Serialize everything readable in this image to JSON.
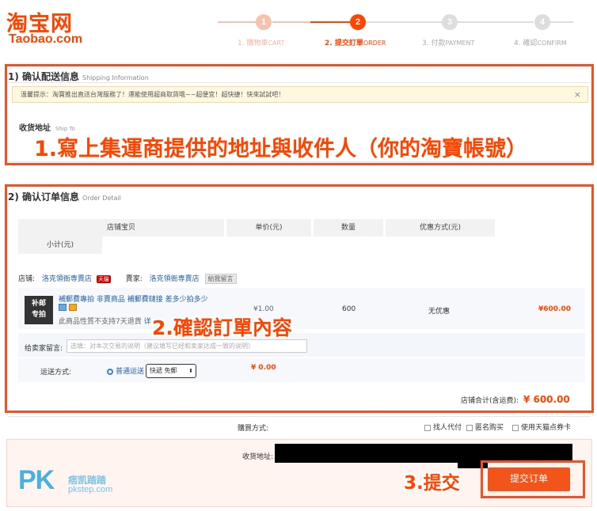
{
  "header": {
    "logo_cn": "淘宝网",
    "logo_en": "Taobao.com",
    "steps": [
      {
        "num": "1",
        "label": "1. 購物車",
        "sub": "CART"
      },
      {
        "num": "2",
        "label": "2. 提交訂單",
        "sub": "ORDER"
      },
      {
        "num": "3",
        "label": "3. 付款",
        "sub": "PAYMENT"
      },
      {
        "num": "4",
        "label": "4. 確認",
        "sub": "CONFIRM"
      }
    ]
  },
  "shipping": {
    "title": "1) 确认配送信息",
    "title_en": "Shipping Information",
    "notice": "溫馨提示：淘寶推出直送台灣服務了！運能使用超商取貨哦~~超便宜！超快捷！快來試試吧！",
    "notice_close": "×",
    "address_label": "收货地址",
    "address_label_en": "Ship To",
    "annotation": "1.寫上集運商提供的地址與收件人（你的淘寶帳號）"
  },
  "order": {
    "title": "2) 确认订单信息",
    "title_en": "Order Detail",
    "columns": [
      "店铺宝贝",
      "单价(元)",
      "数量",
      "优惠方式(元)",
      "小计(元)"
    ],
    "shop_label": "店铺:",
    "shop_name": "洛克領衙専賣店",
    "tmall_badge": "天貓",
    "seller_label": "賣家:",
    "seller_name": "洛克領衙専賣店",
    "contact_seller": "給我留言",
    "item_thumb_line1": "补邮",
    "item_thumb_line2": "专拍",
    "item_title": "補郵費專拍 非賣商品 補郵費鏈接 差多少拍多少",
    "item_note": "此商品性質不支持7天退貨",
    "item_note_link": "详",
    "item_price": "¥1.00",
    "item_qty": "600",
    "item_discount": "无优惠",
    "item_subtotal": "¥600.00",
    "message_label": "给卖家留言:",
    "message_placeholder": "选填：对本次交易的说明（建议填写已经和卖家达成一致的说明）",
    "shipping_label": "运送方式:",
    "shipping_option": "普通运送",
    "shipping_select": "快遞 免郵",
    "shipping_fee": "¥ 0.00",
    "shop_total_label": "店铺合计(含运费):",
    "shop_total": "¥ 600.00",
    "annotation": "2.確認訂單內容"
  },
  "footer": {
    "purchase_method_label": "購買方式:",
    "options": [
      "找人代付",
      "匿名购买",
      "使用天猫点券卡"
    ],
    "address_label": "收货地址:",
    "submit_label": "提交订单",
    "annotation": "3.提交",
    "watermark_pk": "PK",
    "watermark_cn": "痞凯踏踏",
    "watermark_url": "pkstep.com"
  },
  "colors": {
    "brand": "#ff4400",
    "annotation_border": "#f24f23",
    "link": "#2463a9",
    "notice_bg": "#fff8e0"
  }
}
